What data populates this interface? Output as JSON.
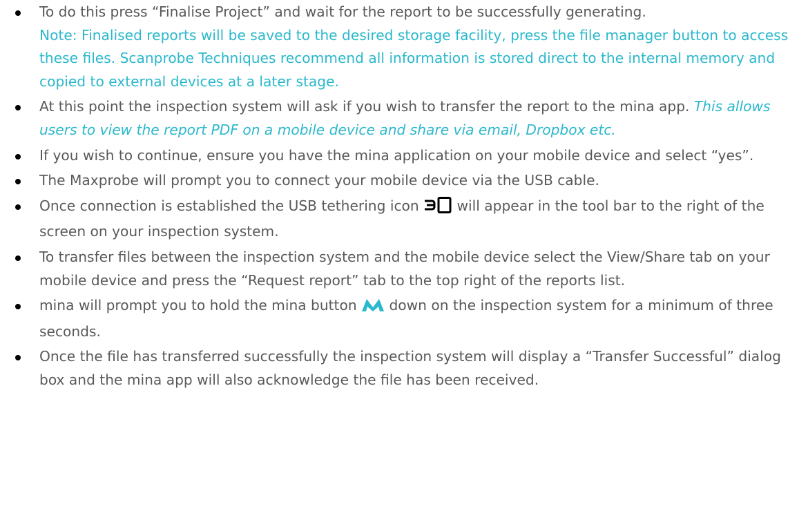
{
  "colors": {
    "body_text": "#595959",
    "accent": "#2bb8cc",
    "bullet": "#000000"
  },
  "items": [
    {
      "text": "To do this press “Finalise Project” and wait for the report to be successfully generating.",
      "note": "Note: Finalised reports will be saved to the desired storage facility, press the file manager button to access these files. Scanprobe Techniques recommend all information is stored direct to the internal memory and copied to external devices at a later stage."
    },
    {
      "text": "At this point the inspection system will ask if you wish to transfer the report to the mina app.",
      "italic_note": "This allows users to view the report PDF on a mobile device and share via email, Dropbox etc."
    },
    {
      "text": "If you wish to continue, ensure you have the mina application on your mobile device and select “yes”."
    },
    {
      "text": "The Maxprobe will prompt you to connect your mobile device via the USB cable."
    },
    {
      "text_before": "Once connection is established the USB tethering icon",
      "icon": "usb-tethering-icon",
      "text_after": "will appear in the tool bar to the right of the screen on your inspection system."
    },
    {
      "text": "To transfer files between the inspection system and the mobile device select the View/Share tab on your mobile device and press the “Request report” tab to the top right of the reports list."
    },
    {
      "text_before": "mina will prompt you to hold the mina button",
      "icon": "mina-logo-icon",
      "text_after": "down on the inspection system for a minimum of three seconds."
    },
    {
      "text": "Once the file has transferred successfully the inspection system will display a “Transfer Successful” dialog box and the mina app will also acknowledge the file has been received."
    }
  ]
}
